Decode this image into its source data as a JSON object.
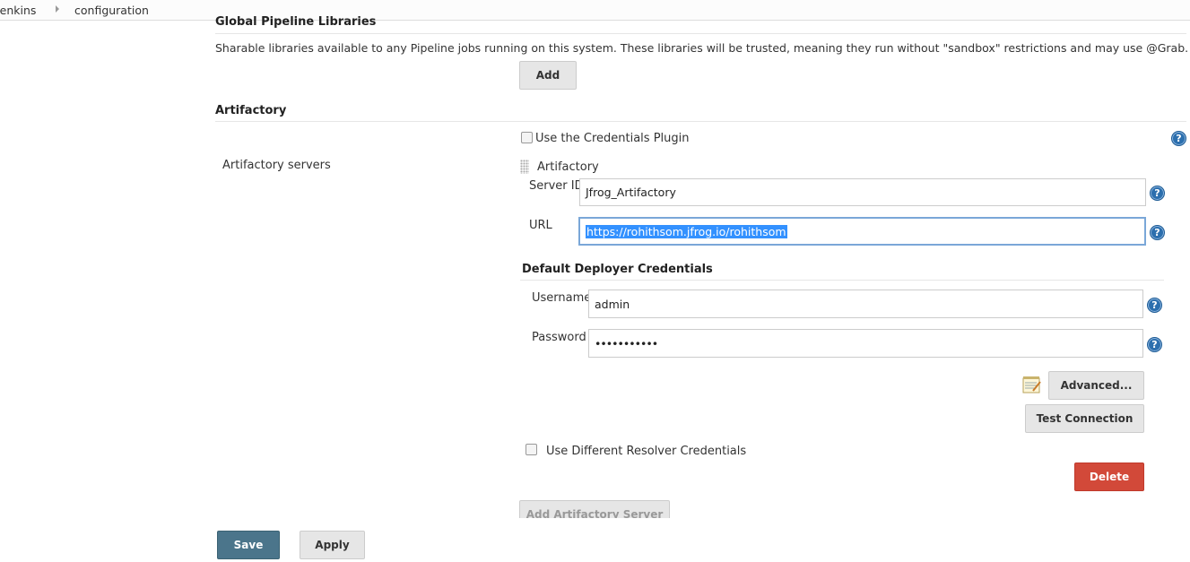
{
  "breadcrumb": {
    "items": [
      "Jenkins",
      "configuration"
    ]
  },
  "global_pipeline": {
    "title": "Global Pipeline Libraries",
    "description": "Sharable libraries available to any Pipeline jobs running on this system. These libraries will be trusted, meaning they run without \"sandbox\" restrictions and may use @Grab.",
    "add_label": "Add"
  },
  "artifactory": {
    "title": "Artifactory",
    "use_credentials_plugin_label": "Use the Credentials Plugin",
    "servers_label": "Artifactory servers",
    "server_block_title": "Artifactory",
    "server_id_label": "Server ID",
    "server_id_value": "Jfrog_Artifactory",
    "url_label": "URL",
    "url_value": "https://rohithsom.jfrog.io/rohithsom",
    "deployer_title": "Default Deployer Credentials",
    "username_label": "Username",
    "username_value": "admin",
    "password_label": "Password",
    "password_value": "•••••••••••",
    "advanced_label": "Advanced...",
    "test_connection_label": "Test Connection",
    "resolver_label": "Use Different Resolver Credentials",
    "delete_label": "Delete",
    "add_server_label": "Add Artifactory Server"
  },
  "footer": {
    "save_label": "Save",
    "apply_label": "Apply"
  },
  "icons": {
    "help": "help-icon",
    "notepad": "notepad-icon",
    "drag": "drag-handle-icon"
  },
  "colors": {
    "save": "#4b758b",
    "delete": "#d24939",
    "help": "#2c6fae",
    "selection": "#3391ff"
  }
}
